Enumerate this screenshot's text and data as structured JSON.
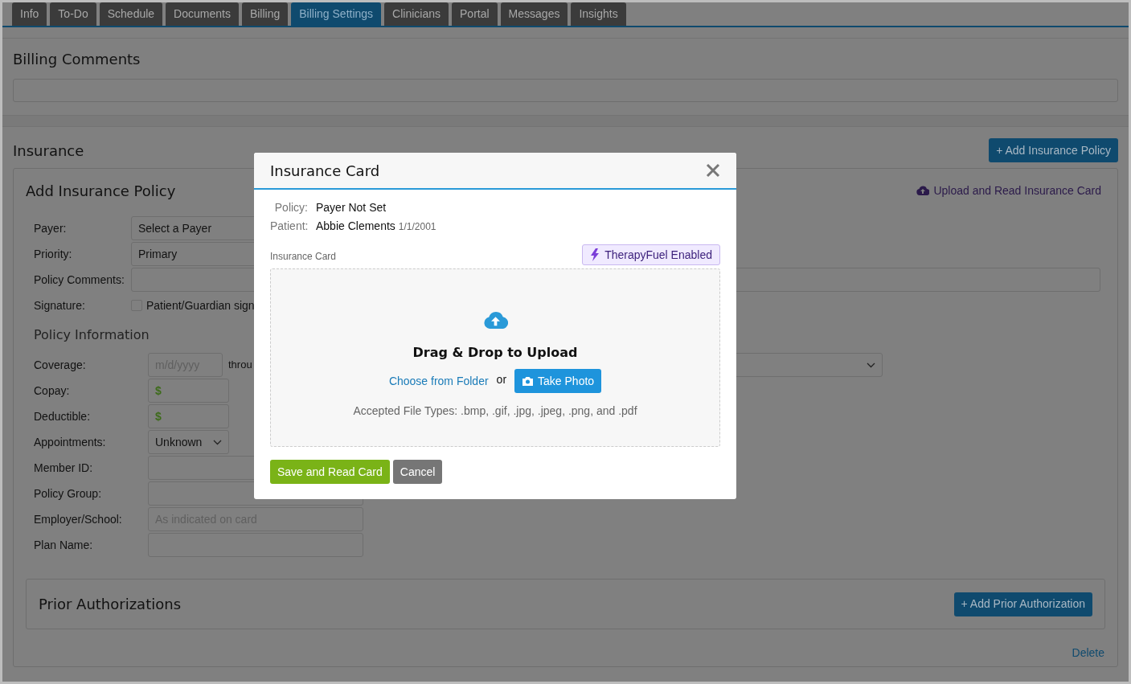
{
  "tabs": [
    {
      "label": "Info",
      "selected": false
    },
    {
      "label": "To-Do",
      "selected": false
    },
    {
      "label": "Schedule",
      "selected": false
    },
    {
      "label": "Documents",
      "selected": false
    },
    {
      "label": "Billing",
      "selected": false
    },
    {
      "label": "Billing Settings",
      "selected": true
    },
    {
      "label": "Clinicians",
      "selected": false
    },
    {
      "label": "Portal",
      "selected": false
    },
    {
      "label": "Messages",
      "selected": false
    },
    {
      "label": "Insights",
      "selected": false
    }
  ],
  "billing_comments": {
    "title": "Billing Comments"
  },
  "insurance": {
    "title": "Insurance",
    "add_button": "+ Add Insurance Policy"
  },
  "policy_form": {
    "title": "Add Insurance Policy",
    "upload_link": "Upload and Read Insurance Card",
    "fields": [
      {
        "label": "Payer:",
        "kind": "select",
        "value": "Select a Payer"
      },
      {
        "label": "Priority:",
        "kind": "select",
        "value": "Primary"
      },
      {
        "label": "Policy Comments:",
        "kind": "wide"
      },
      {
        "label": "Signature:",
        "kind": "checkbox",
        "text": "Patient/Guardian sign",
        "checked": false
      }
    ],
    "info_title": "Policy Information",
    "info_fields": [
      {
        "label": "Coverage:",
        "kind": "date_range",
        "placeholder": "m/d/yyyy",
        "joiner": "throu"
      },
      {
        "label": "Copay:",
        "kind": "money",
        "prefix": "$"
      },
      {
        "label": "Deductible:",
        "kind": "money",
        "prefix": "$"
      },
      {
        "label": "Appointments:",
        "kind": "select",
        "value": "Unknown"
      },
      {
        "label": "Member ID:",
        "kind": "text"
      },
      {
        "label": "Policy Group:",
        "kind": "text"
      },
      {
        "label": "Employer/School:",
        "kind": "text",
        "placeholder": "As indicated on card"
      },
      {
        "label": "Plan Name:",
        "kind": "text"
      }
    ]
  },
  "prior_authorizations": {
    "title": "Prior Authorizations",
    "add_button": "+ Add Prior Authorization"
  },
  "delete_link": "Delete",
  "modal": {
    "title": "Insurance Card",
    "info": [
      {
        "label": "Policy:",
        "value": "Payer Not Set"
      },
      {
        "label": "Patient:",
        "value": "Abbie Clements",
        "note": "1/1/2001"
      }
    ],
    "section_label": "Insurance Card",
    "badge": "TherapyFuel Enabled",
    "drop_title": "Drag & Drop to Upload",
    "folder_link": "Choose from Folder",
    "or": "or",
    "photo_button": "Take Photo",
    "accepted": "Accepted File Types: .bmp, .gif, .jpg, .jpeg, .png, and .pdf",
    "buttons": [
      {
        "label": "Save and Read Card",
        "kind": "primary"
      },
      {
        "label": "Cancel",
        "kind": "secondary"
      }
    ]
  }
}
